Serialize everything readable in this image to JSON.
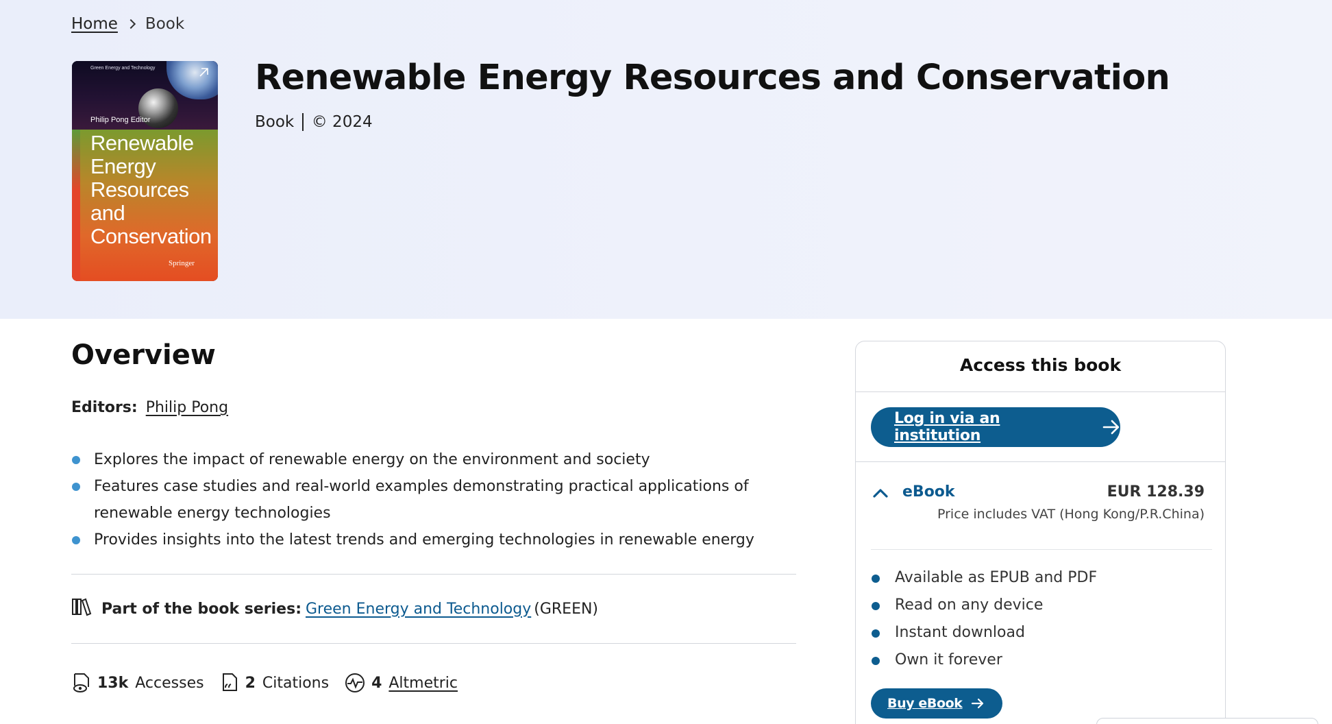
{
  "breadcrumb": {
    "home": "Home",
    "current": "Book"
  },
  "cover": {
    "series": "Green Energy and Technology",
    "editor": "Philip Pong  Editor",
    "title": "Renewable Energy Resources and Conservation",
    "publisher": "Springer"
  },
  "book": {
    "title": "Renewable Energy Resources and Conservation",
    "type": "Book",
    "copyright": "© 2024"
  },
  "overview": {
    "heading": "Overview",
    "editors_label": "Editors:",
    "editor_name": "Philip Pong",
    "features": [
      "Explores the impact of renewable energy on the environment and society",
      "Features case studies and real-world examples demonstrating practical applications of renewable energy technologies",
      "Provides insights into the latest trends and emerging technologies in renewable energy"
    ],
    "series_label": "Part of the book series:",
    "series_name": "Green Energy and Technology",
    "series_abbr": "(GREEN)"
  },
  "metrics": {
    "accesses_count": "13k",
    "accesses_label": "Accesses",
    "citations_count": "2",
    "citations_label": "Citations",
    "altmetric_count": "4",
    "altmetric_label": "Altmetric"
  },
  "access_panel": {
    "title": "Access this book",
    "login_button": "Log in via an institution",
    "ebook_label": "eBook",
    "ebook_price": "EUR 128.39",
    "vat_note": "Price includes VAT (Hong Kong/P.R.China)",
    "perks": [
      "Available as EPUB and PDF",
      "Read on any device",
      "Instant download",
      "Own it forever"
    ],
    "buy_button": "Buy eBook"
  },
  "colors": {
    "hero_bg": "#eef1fb",
    "primary": "#0d5d8f",
    "link": "#0c5a8f",
    "bullet": "#3e93cf"
  },
  "icons": [
    "chevron-right-icon",
    "book-series-icon",
    "accesses-icon",
    "citations-icon",
    "altmetric-icon",
    "arrow-right-icon",
    "chevron-up-icon",
    "expand-icon"
  ]
}
